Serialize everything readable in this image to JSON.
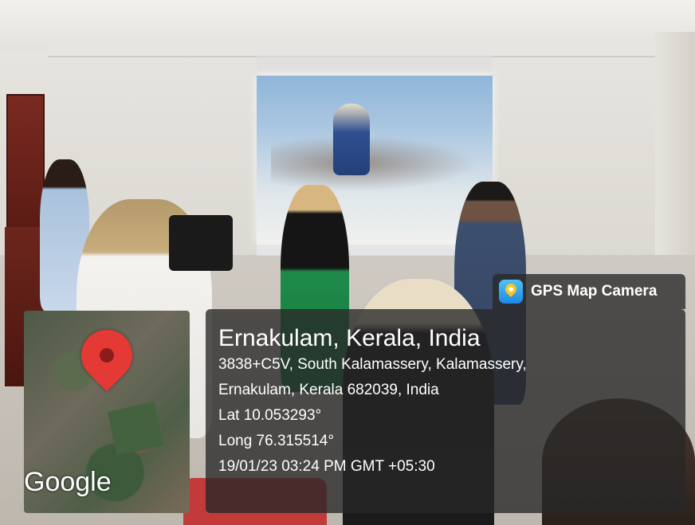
{
  "badge": {
    "label": "GPS Map Camera",
    "icon": "gps-map-camera-app-icon"
  },
  "location": {
    "place": "Ernakulam, Kerala, India",
    "address_line1": "3838+C5V, South Kalamassery, Kalamassery,",
    "address_line2": "Ernakulam, Kerala 682039, India",
    "lat": "Lat 10.053293°",
    "long": "Long 76.315514°",
    "datetime": "19/01/23 03:24 PM GMT +05:30"
  },
  "map": {
    "logo_text": "Google",
    "pin_color": "#e53935"
  }
}
